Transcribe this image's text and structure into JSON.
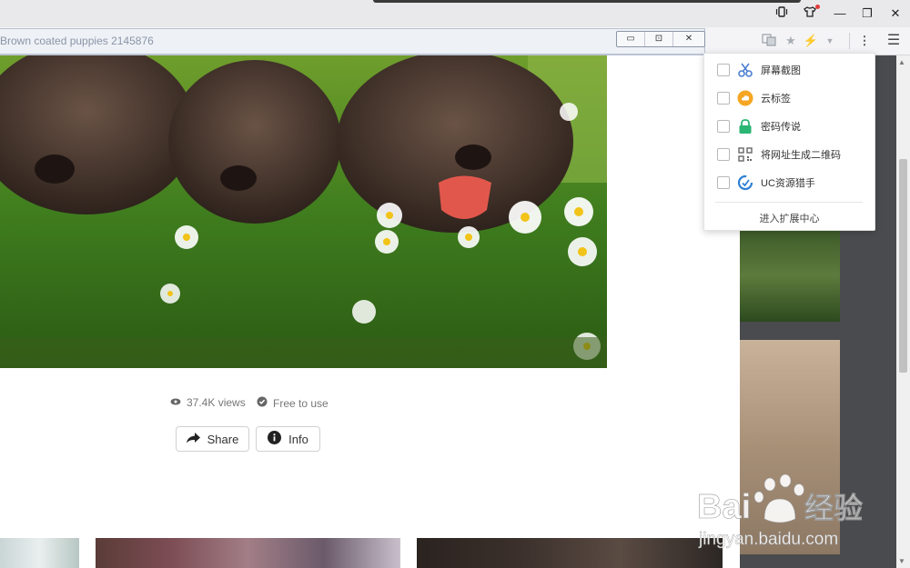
{
  "window": {
    "popup_title": "Brown coated puppies 2145876",
    "controls": [
      "▭",
      "⊡",
      "✕"
    ]
  },
  "titlebar": {
    "minimize": "—",
    "restore": "❐",
    "close": "✕"
  },
  "addressbar_icons": [
    "translate-icon",
    "star-icon",
    "bolt-icon",
    "chevron-down-icon",
    "more-vert-icon",
    "hamburger-icon"
  ],
  "content": {
    "views": "37.4K views",
    "license": "Free to use",
    "share_label": "Share",
    "info_label": "Info"
  },
  "extension_menu": {
    "items": [
      {
        "label": "屏幕截图",
        "icon": "scissors-icon"
      },
      {
        "label": "云标签",
        "icon": "cloud-tag-icon"
      },
      {
        "label": "密码传说",
        "icon": "lock-icon"
      },
      {
        "label": "将网址生成二维码",
        "icon": "qr-code-icon"
      },
      {
        "label": "UC资源猎手",
        "icon": "uc-hunter-icon"
      }
    ],
    "footer": "进入扩展中心"
  },
  "watermark": {
    "brand": "Bai",
    "brand_tail": "经验",
    "url": "jingyan.baidu.com"
  },
  "colors": {
    "accent_green": "#2bb673",
    "cloud_orange": "#f5a623",
    "uc_blue": "#2f7fd4"
  }
}
